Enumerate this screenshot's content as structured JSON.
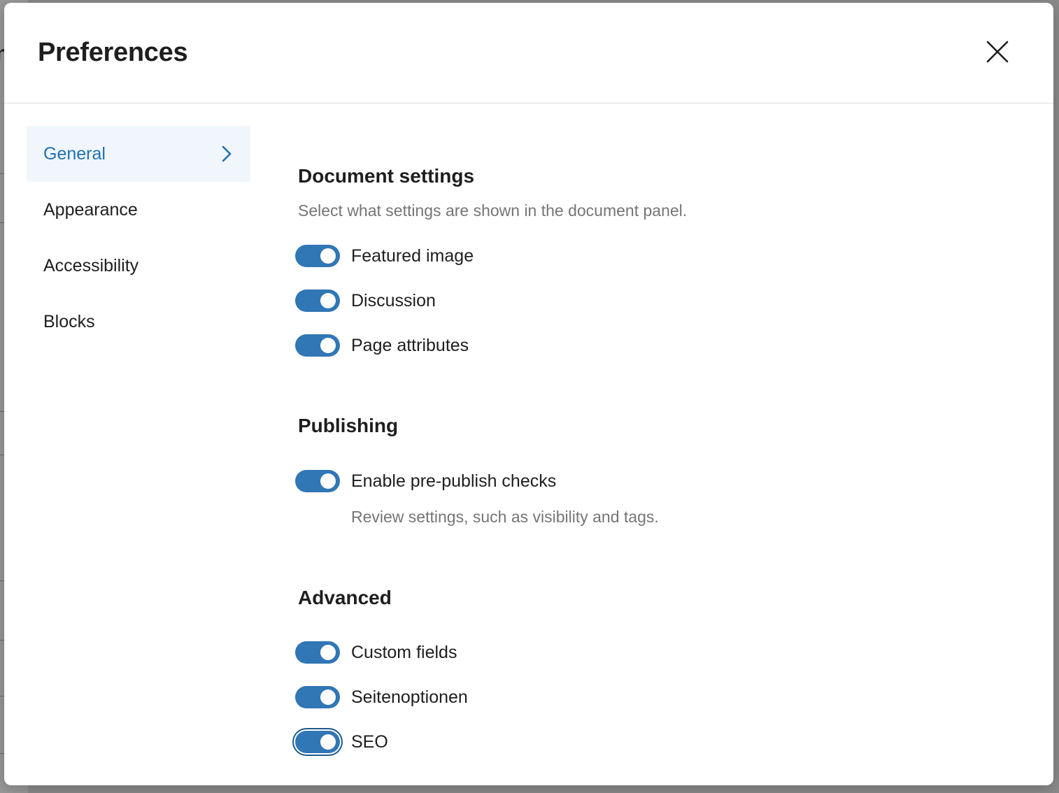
{
  "modal": {
    "title": "Preferences",
    "close_icon": "close-icon"
  },
  "nav": {
    "items": [
      {
        "label": "General",
        "active": true
      },
      {
        "label": "Appearance",
        "active": false
      },
      {
        "label": "Accessibility",
        "active": false
      },
      {
        "label": "Blocks",
        "active": false
      }
    ]
  },
  "sections": {
    "document": {
      "title": "Document settings",
      "description": "Select what settings are shown in the document panel.",
      "toggles": [
        {
          "label": "Featured image",
          "checked": true
        },
        {
          "label": "Discussion",
          "checked": true
        },
        {
          "label": "Page attributes",
          "checked": true
        }
      ]
    },
    "publishing": {
      "title": "Publishing",
      "toggles": [
        {
          "label": "Enable pre-publish checks",
          "checked": true,
          "help": "Review settings, such as visibility and tags."
        }
      ]
    },
    "advanced": {
      "title": "Advanced",
      "toggles": [
        {
          "label": "Custom fields",
          "checked": true
        },
        {
          "label": "Seitenoptionen",
          "checked": true
        },
        {
          "label": "SEO",
          "checked": true,
          "focused": true
        }
      ]
    }
  },
  "colors": {
    "accent": "#2271b1",
    "toggle_on": "#3176b5",
    "active_nav_bg": "#f0f6fc",
    "muted_text": "#757575"
  }
}
